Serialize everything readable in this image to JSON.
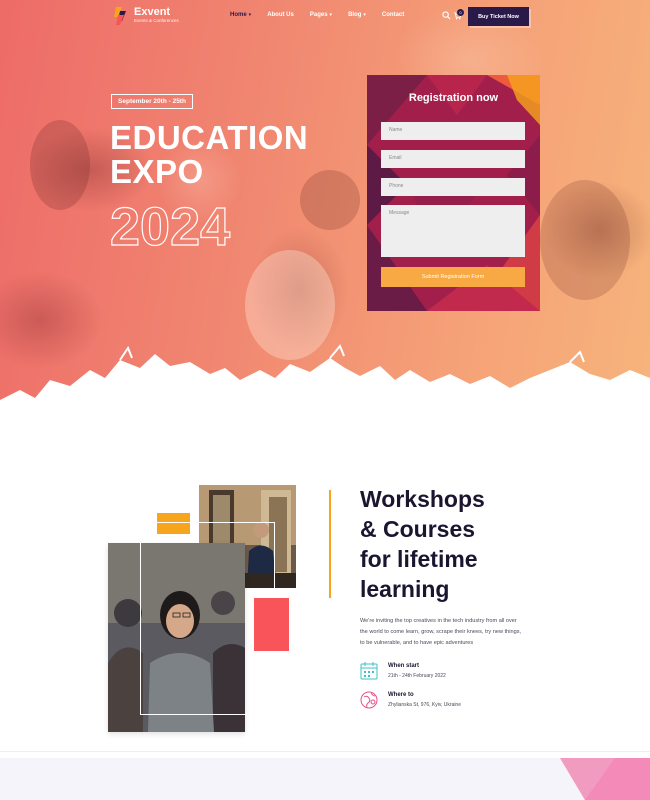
{
  "brand": {
    "name": "Exvent",
    "tagline": "Events & Conferences"
  },
  "nav": {
    "items": [
      {
        "label": "Home",
        "has_dropdown": true,
        "active": true
      },
      {
        "label": "About Us",
        "has_dropdown": false,
        "active": false
      },
      {
        "label": "Pages",
        "has_dropdown": true,
        "active": false
      },
      {
        "label": "Blog",
        "has_dropdown": true,
        "active": false
      },
      {
        "label": "Contact",
        "has_dropdown": false,
        "active": false
      }
    ],
    "cart_count": "0",
    "cta_label": "Buy Ticket Now"
  },
  "hero": {
    "date": "September 20th - 25th",
    "title_line1": "EDUCATION",
    "title_line2": "EXPO",
    "year": "2024"
  },
  "registration": {
    "title": "Registration now",
    "fields": {
      "name": "Name",
      "email": "Email",
      "phone": "Phone",
      "message": "Message"
    },
    "submit_label": "Submit Registration Form"
  },
  "about": {
    "heading_line1": "Workshops",
    "heading_line2": "& Courses",
    "heading_line3": "for lifetime",
    "heading_line4": "learning",
    "description": "We're inviting the top creatives in the tech industry from all over the world to come learn, grow, scrape their knees, try new things, to be vulnerable, and to have epic adventures",
    "when_label": "When start",
    "when_value": "21th - 24th February 2022",
    "where_label": "Where to",
    "where_value": "Zhylianska St, 976, Kyiv, Ukraine"
  },
  "colors": {
    "primary_dark": "#2a1a4a",
    "accent_orange": "#f6a51d",
    "accent_red": "#f8545a",
    "form_bg": "#a1204c",
    "submit": "#f9a944"
  }
}
